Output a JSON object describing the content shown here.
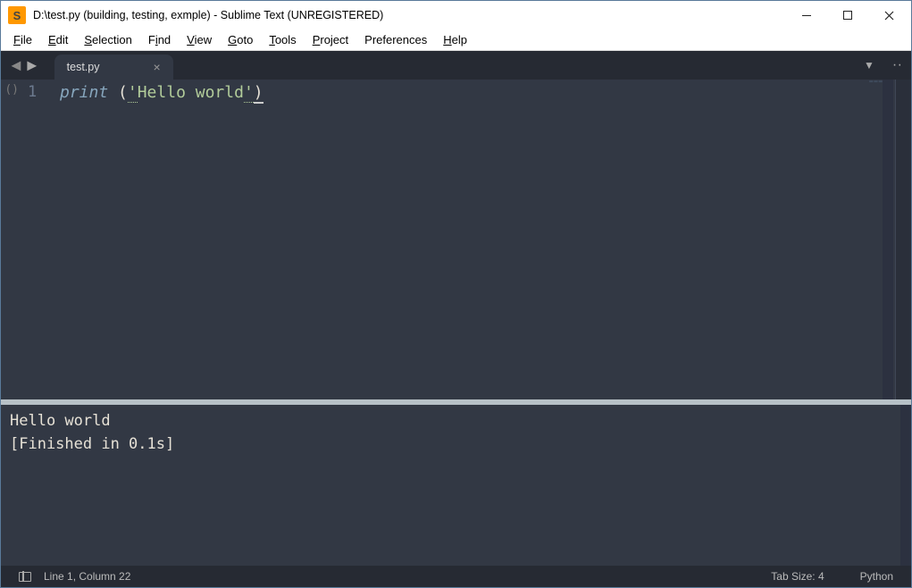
{
  "titlebar": {
    "icon_letter": "S",
    "text": "D:\\test.py (building, testing, exmple) - Sublime Text (UNREGISTERED)"
  },
  "menu": {
    "file": {
      "u": "F",
      "rest": "ile"
    },
    "edit": {
      "u": "E",
      "rest": "dit"
    },
    "selection": {
      "u": "S",
      "rest": "election"
    },
    "find": {
      "u": "F",
      "rest": "ind",
      "alt_u": "i",
      "pre": "F",
      "post": "nd"
    },
    "view": {
      "u": "V",
      "rest": "iew"
    },
    "goto": {
      "u": "G",
      "rest": "oto"
    },
    "tools": {
      "u": "T",
      "rest": "ools"
    },
    "project": {
      "u": "P",
      "rest": "roject"
    },
    "preferences": {
      "label": "Preferences"
    },
    "help": {
      "u": "H",
      "rest": "elp"
    }
  },
  "tab": {
    "name": "test.py"
  },
  "editor": {
    "fold_marker": "()",
    "line_number": "1",
    "tokens": {
      "func": "print",
      "space": " ",
      "lparen": "(",
      "quote": "'",
      "string": "Hello world",
      "rparen": ")"
    }
  },
  "output": {
    "line1": "Hello world",
    "line2": "[Finished in 0.1s]"
  },
  "statusbar": {
    "position": "Line 1, Column 22",
    "tab_size": "Tab Size: 4",
    "syntax": "Python"
  }
}
